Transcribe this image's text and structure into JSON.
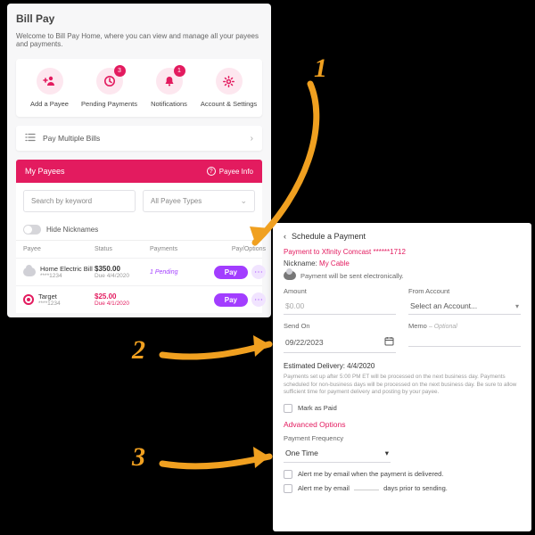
{
  "left": {
    "title": "Bill Pay",
    "welcome": "Welcome to Bill Pay Home, where you can view and manage all your payees and payments.",
    "actions": {
      "add": "Add a Payee",
      "pending": "Pending Payments",
      "pending_badge": "3",
      "notifications": "Notifications",
      "notifications_badge": "1",
      "settings": "Account & Settings"
    },
    "multipay": "Pay Multiple Bills",
    "mypayees": "My Payees",
    "payee_info": "Payee Info",
    "search_placeholder": "Search by keyword",
    "type_filter": "All Payee Types",
    "hide_nicknames": "Hide Nicknames",
    "columns": {
      "payee": "Payee",
      "status": "Status",
      "payments": "Payments",
      "payoptions": "Pay/Options"
    },
    "rows": [
      {
        "name": "Home Electric Bill",
        "acct": "****1234",
        "amount": "$350.00",
        "due": "Due 4/4/2020",
        "payments": "1 Pending",
        "pay": "Pay",
        "overdue": false
      },
      {
        "name": "Target",
        "acct": "****1234",
        "amount": "$25.00",
        "due": "Due 4/1/2020",
        "payments": "",
        "pay": "Pay",
        "overdue": true
      }
    ]
  },
  "right": {
    "back": "Schedule a Payment",
    "payto": "Payment to Xfinity Comcast ******1712",
    "nick_label": "Nickname:",
    "nick_value": "My Cable",
    "sent": "Payment will be sent electronically.",
    "amount_label": "Amount",
    "amount_value": "$0.00",
    "from_label": "From Account",
    "from_value": "Select an Account...",
    "sendon_label": "Send On",
    "sendon_value": "09/22/2023",
    "memo_label": "Memo",
    "memo_optional": "– Optional",
    "est": "Estimated Delivery: 4/4/2020",
    "disclaimer": "Payments set up after 5:00 PM ET will be processed on the next business day. Payments scheduled for non-business days will be processed on the next business day. Be sure to allow sufficient time for payment delivery and posting by your payee.",
    "mark_paid": "Mark as Paid",
    "advanced": "Advanced Options",
    "freq_label": "Payment Frequency",
    "freq_value": "One Time",
    "alert_delivered": "Alert me by email when the payment is delivered.",
    "alert_prefix": "Alert me by email",
    "alert_suffix": "days prior to sending."
  },
  "markers": {
    "one": "1",
    "two": "2",
    "three": "3"
  }
}
